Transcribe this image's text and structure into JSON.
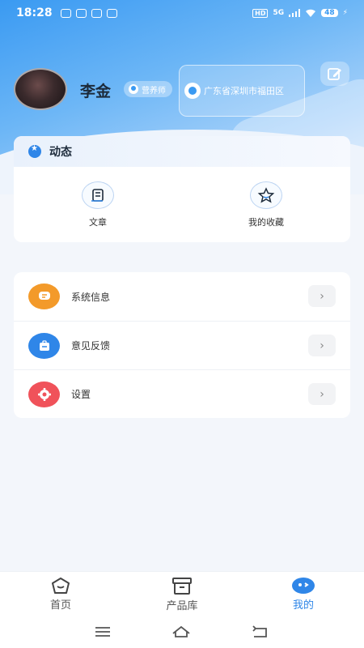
{
  "status_bar": {
    "time": "18:28",
    "hd": "HD",
    "network": "5G",
    "battery": "48"
  },
  "profile": {
    "name": "李金",
    "role": "营养师",
    "location": "广东省深圳市福田区"
  },
  "dynamics": {
    "title": "动态",
    "items": [
      {
        "label": "文章",
        "icon": "article-icon"
      },
      {
        "label": "我的收藏",
        "icon": "favorites-star-icon"
      }
    ]
  },
  "menu": {
    "items": [
      {
        "label": "系统信息",
        "icon": "message-icon",
        "color": "#f39a2a"
      },
      {
        "label": "意见反馈",
        "icon": "feedback-briefcase-icon",
        "color": "#2f86e8"
      },
      {
        "label": "设置",
        "icon": "gear-icon",
        "color": "#f0525a"
      }
    ]
  },
  "tabbar": {
    "items": [
      {
        "label": "首页",
        "active": false
      },
      {
        "label": "产品库",
        "active": false
      },
      {
        "label": "我的",
        "active": true
      }
    ]
  },
  "colors": {
    "accent": "#2f86e8",
    "hero_start": "#3a9af2"
  }
}
